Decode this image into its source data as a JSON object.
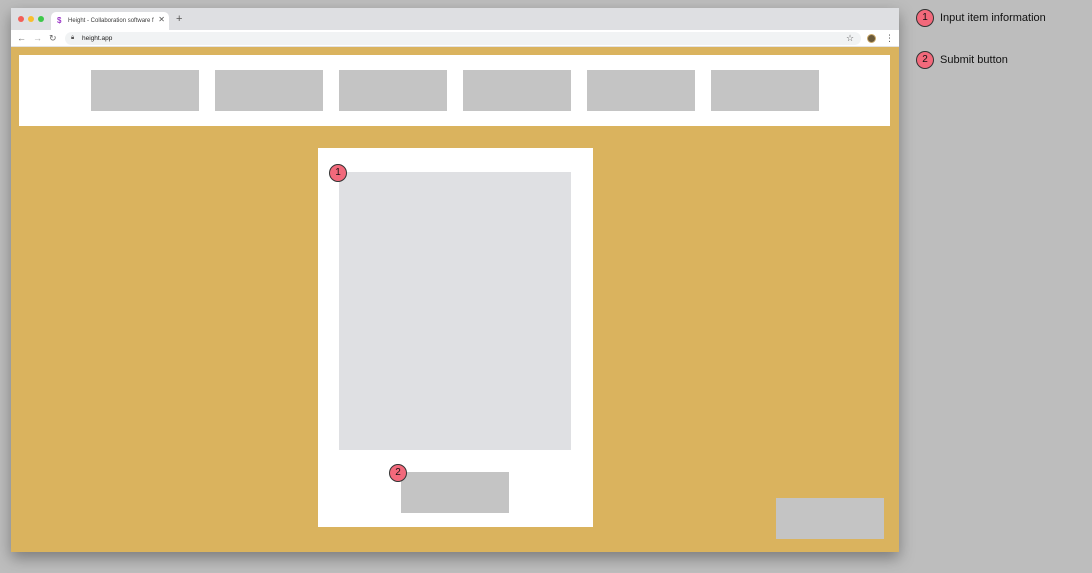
{
  "browser": {
    "tab_title": "Height - Collaboration software f",
    "tab_favicon": "height-logo-icon",
    "url": "height.app"
  },
  "page": {
    "nav_blocks": [
      "",
      "",
      "",
      "",
      "",
      ""
    ],
    "background_color": "#dab35e"
  },
  "annotations": [
    {
      "number": "1",
      "label": "Input item information"
    },
    {
      "number": "2",
      "label": "Submit button"
    }
  ],
  "colors": {
    "marker": "#f2697b",
    "placeholder": "#c4c4c4",
    "input_area": "#dfe0e3"
  }
}
